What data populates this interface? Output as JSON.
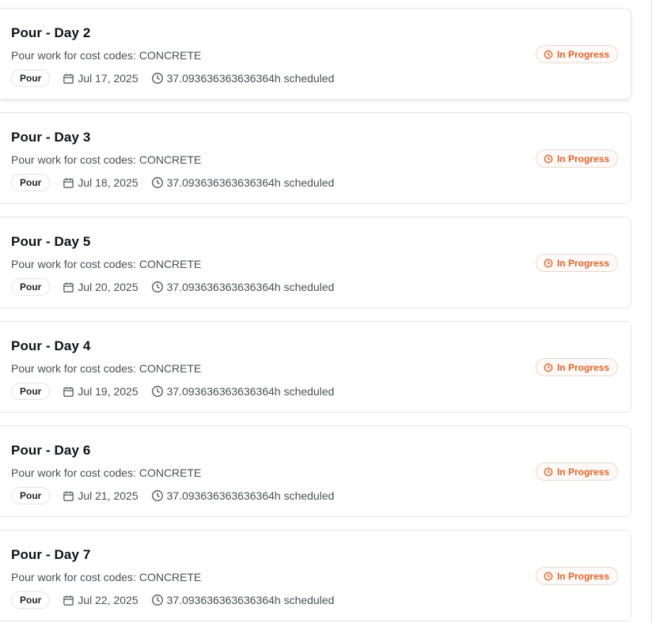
{
  "tasks": [
    {
      "title": "Pour - Day 2",
      "description": "Pour work for cost codes: CONCRETE",
      "type": "Pour",
      "date": "Jul 17, 2025",
      "hours": "37.093636363636364h scheduled",
      "status": "In Progress",
      "calendar_icon": "calendar-icon",
      "clock_icon": "clock-icon"
    },
    {
      "title": "Pour - Day 3",
      "description": "Pour work for cost codes: CONCRETE",
      "type": "Pour",
      "date": "Jul 18, 2025",
      "hours": "37.093636363636364h scheduled",
      "status": "In Progress",
      "calendar_icon": "calendar-icon",
      "clock_icon": "clock-icon"
    },
    {
      "title": "Pour - Day 5",
      "description": "Pour work for cost codes: CONCRETE",
      "type": "Pour",
      "date": "Jul 20, 2025",
      "hours": "37.093636363636364h scheduled",
      "status": "In Progress",
      "calendar_icon": "calendar-icon",
      "clock_icon": "clock-icon"
    },
    {
      "title": "Pour - Day 4",
      "description": "Pour work for cost codes: CONCRETE",
      "type": "Pour",
      "date": "Jul 19, 2025",
      "hours": "37.093636363636364h scheduled",
      "status": "In Progress",
      "calendar_icon": "calendar-icon",
      "clock_icon": "clock-icon"
    },
    {
      "title": "Pour - Day 6",
      "description": "Pour work for cost codes: CONCRETE",
      "type": "Pour",
      "date": "Jul 21, 2025",
      "hours": "37.093636363636364h scheduled",
      "status": "In Progress",
      "calendar_icon": "calendar-icon",
      "clock_icon": "clock-icon"
    },
    {
      "title": "Pour - Day 7",
      "description": "Pour work for cost codes: CONCRETE",
      "type": "Pour",
      "date": "Jul 22, 2025",
      "hours": "37.093636363636364h scheduled",
      "status": "In Progress",
      "calendar_icon": "calendar-icon",
      "clock_icon": "clock-icon"
    }
  ],
  "colors": {
    "status_accent": "#e4622a",
    "status_border": "#e9d7cd",
    "card_border": "#e3e5e8",
    "title_text": "#0d1117",
    "secondary_text": "#4a5057"
  }
}
